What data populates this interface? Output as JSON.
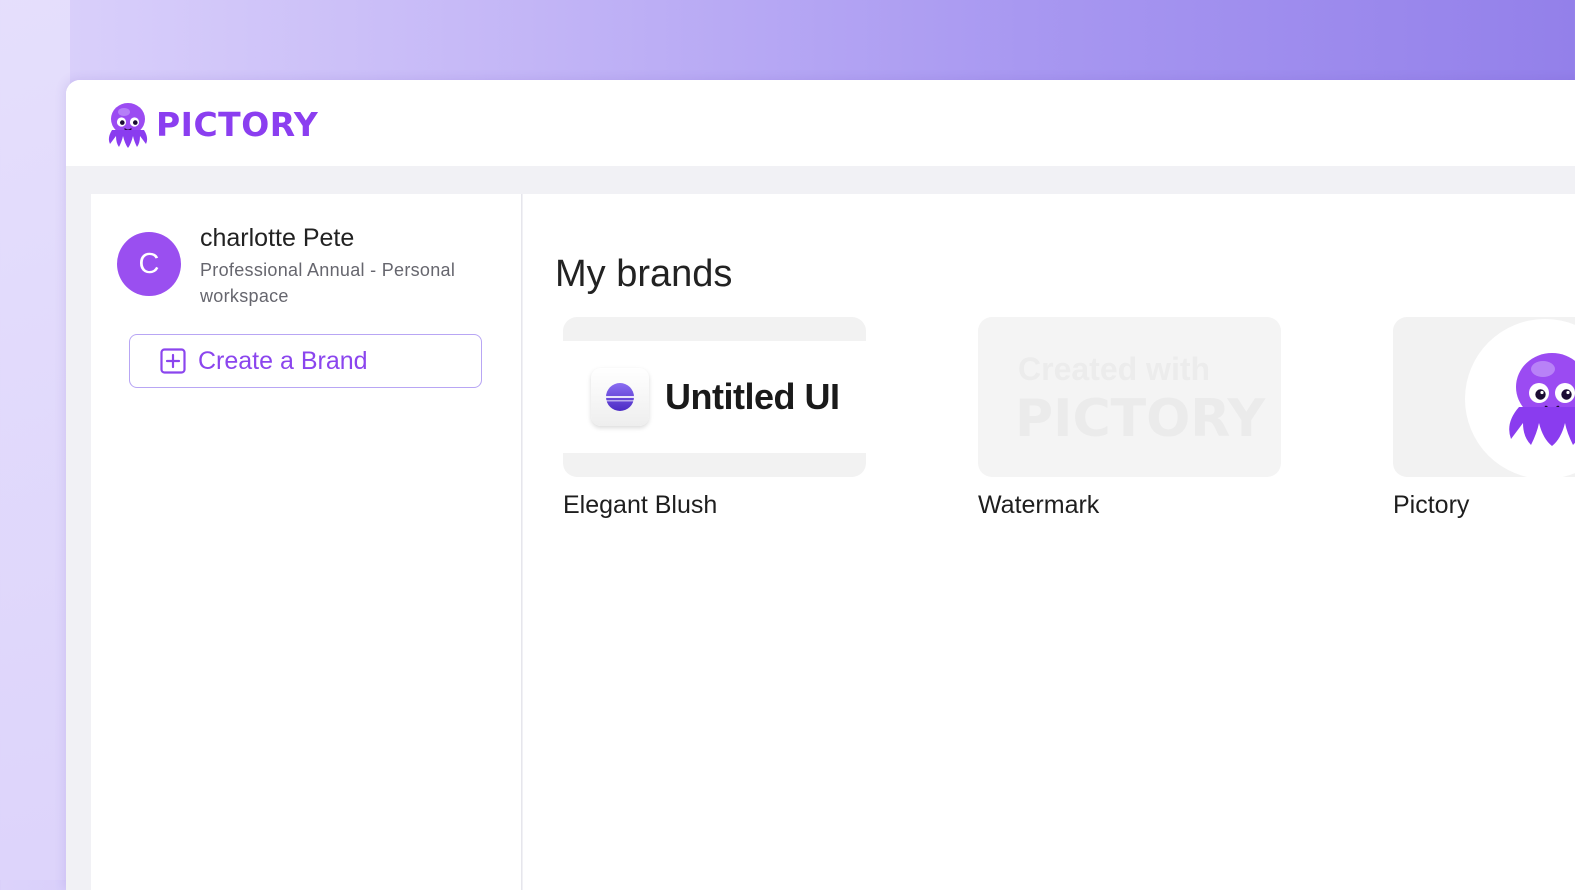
{
  "app": {
    "logo_text": "PICTORY",
    "logo_icon": "octopus-logo-icon",
    "brand_color": "#8b3ef0"
  },
  "user": {
    "avatar_initial": "C",
    "name": "charlotte Pete",
    "plan": "Professional Annual - Personal workspace",
    "avatar_color": "#9a4ff0"
  },
  "sidebar": {
    "create_brand_label": "Create a Brand",
    "create_brand_icon": "plus-square-icon"
  },
  "main": {
    "title": "My brands",
    "brands": [
      {
        "label": "Elegant Blush",
        "thumbnail_text": "Untitled UI"
      },
      {
        "label": "Watermark",
        "thumbnail_line1": "Created with",
        "thumbnail_line2": "PICTORY"
      },
      {
        "label": "Pictory",
        "thumbnail_icon": "octopus-mascot-icon"
      }
    ]
  }
}
